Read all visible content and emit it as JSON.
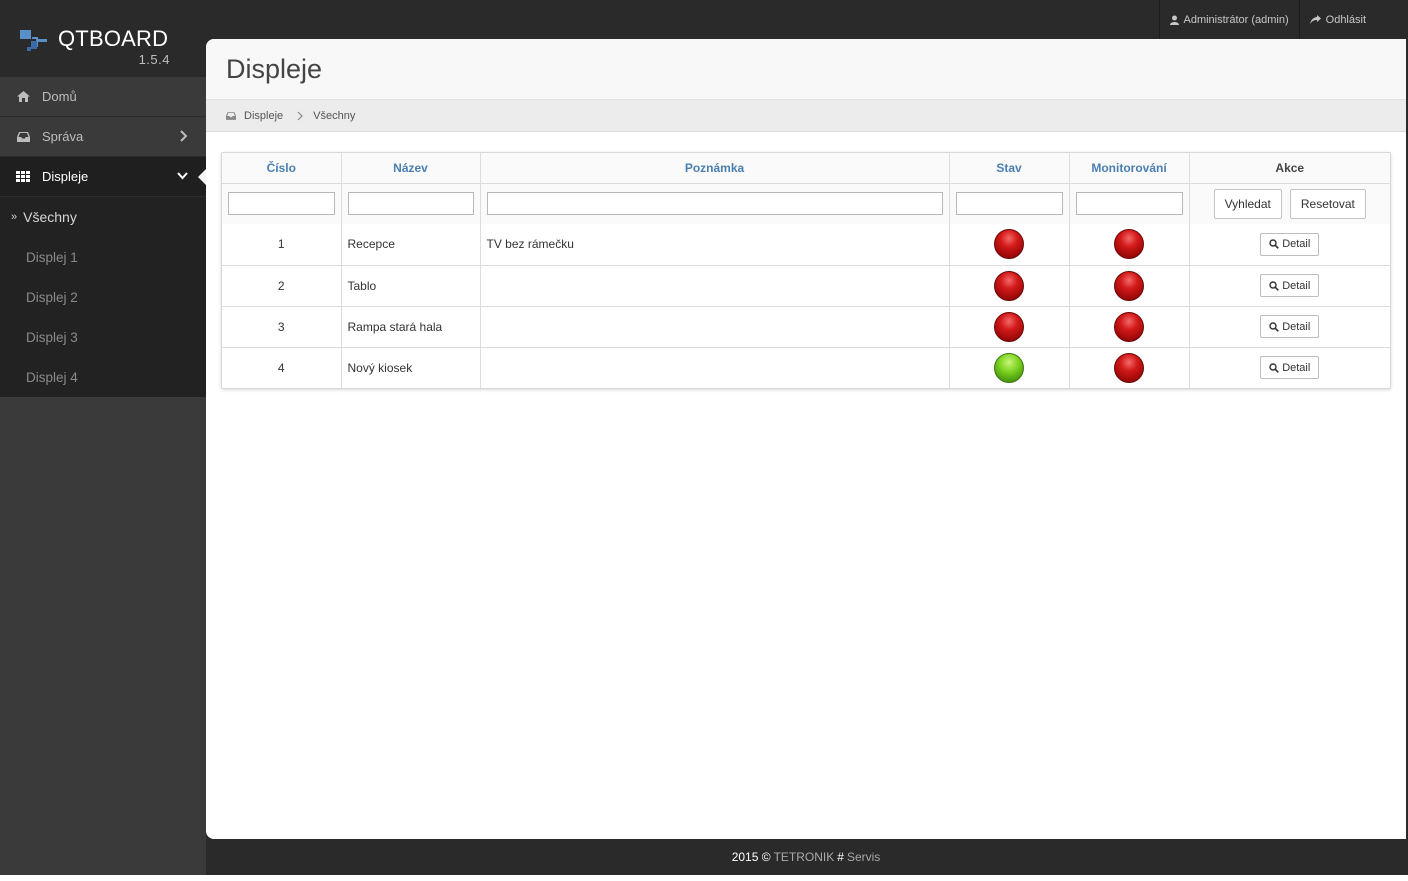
{
  "app": {
    "name": "QTBOARD",
    "version": "1.5.4"
  },
  "topbar": {
    "user": "Administrátor (admin)",
    "logout": "Odhlásit"
  },
  "sidebar": {
    "items": [
      {
        "label": "Domů",
        "icon": "home-icon"
      },
      {
        "label": "Správa",
        "icon": "inbox-icon"
      },
      {
        "label": "Displeje",
        "icon": "grid-icon"
      }
    ],
    "subitems": [
      {
        "label": "Všechny"
      },
      {
        "label": "Displej 1"
      },
      {
        "label": "Displej 2"
      },
      {
        "label": "Displej 3"
      },
      {
        "label": "Displej 4"
      }
    ]
  },
  "page": {
    "title": "Displeje"
  },
  "breadcrumb": {
    "root": "Displeje",
    "current": "Všechny"
  },
  "table": {
    "columns": [
      "Číslo",
      "Název",
      "Poznámka",
      "Stav",
      "Monitorování",
      "Akce"
    ],
    "search_label": "Vyhledat",
    "reset_label": "Resetovat",
    "detail_label": "Detail",
    "rows": [
      {
        "cislo": "1",
        "nazev": "Recepce",
        "poznamka": "TV bez rámečku",
        "stav": "red",
        "monitorovani": "red"
      },
      {
        "cislo": "2",
        "nazev": "Tablo",
        "poznamka": "",
        "stav": "red",
        "monitorovani": "red"
      },
      {
        "cislo": "3",
        "nazev": "Rampa stará hala",
        "poznamka": "",
        "stav": "red",
        "monitorovani": "red"
      },
      {
        "cislo": "4",
        "nazev": "Nový kiosek",
        "poznamka": "",
        "stav": "green",
        "monitorovani": "red"
      }
    ]
  },
  "footer": {
    "year": "2015 ©",
    "brand": "TETRONIK",
    "hash": "#",
    "servis": "Servis"
  },
  "colors": {
    "accent": "#4a7fb0",
    "status_red": "#d31a1a",
    "status_green": "#7ed321"
  }
}
